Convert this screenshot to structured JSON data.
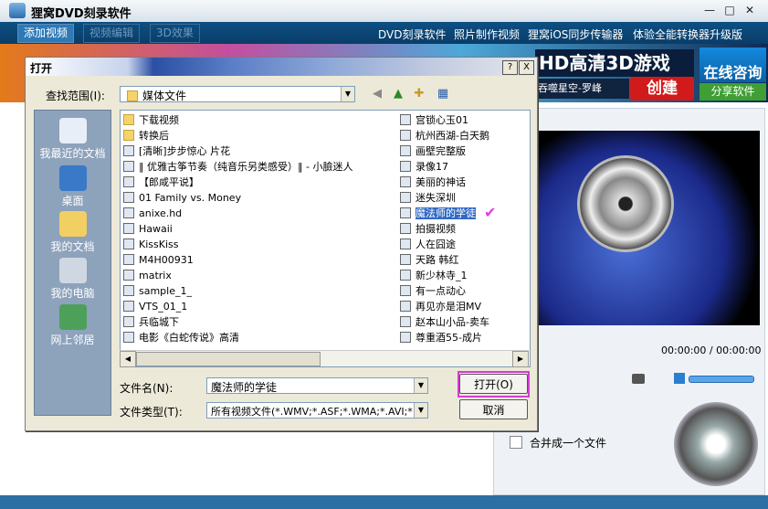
{
  "app": {
    "title": "狸窝DVD刻录软件",
    "min": "—",
    "max": "□",
    "close": "✕"
  },
  "toolbar": {
    "add_video": "添加视频",
    "edit_video": "视频编辑",
    "effect_3d": "3D效果",
    "links": [
      "DVD刻录软件",
      "照片制作视频",
      "狸窝iOS同步传输器",
      "体验全能转换器升级版"
    ]
  },
  "ad": {
    "headline": "HD高清3D游戏",
    "sub": "吞噬星空-罗峰",
    "create": "创建",
    "consult": "在线咨询",
    "share": "分享软件"
  },
  "player": {
    "time": "00:00:00 / 00:00:00"
  },
  "merge_label": "合并成一个文件",
  "dialog": {
    "title": "打开",
    "help": "?",
    "close": "X",
    "lookin_label": "查找范围(I):",
    "lookin_value": "媒体文件",
    "places": [
      "我最近的文档",
      "桌面",
      "我的文档",
      "我的电脑",
      "网上邻居"
    ],
    "files_left": [
      {
        "name": "下载视频",
        "type": "folder"
      },
      {
        "name": "转换后",
        "type": "folder"
      },
      {
        "name": "[清晰]步步惊心 片花",
        "type": "QT"
      },
      {
        "name": "‖ 优雅古筝节奏（纯音乐另类感受）‖ - 小臉迷人",
        "type": "WAV"
      },
      {
        "name": "【郎咸平说】",
        "type": "FLV"
      },
      {
        "name": "01 Family vs. Money",
        "type": "MKV"
      },
      {
        "name": "anixe.hd",
        "type": "TS"
      },
      {
        "name": "Hawaii",
        "type": "MPG"
      },
      {
        "name": "KissKiss",
        "type": "QT"
      },
      {
        "name": "M4H00931",
        "type": "QT"
      },
      {
        "name": "matrix",
        "type": "MP4"
      },
      {
        "name": "sample_1_",
        "type": "VOB"
      },
      {
        "name": "VTS_01_1",
        "type": "VOB"
      },
      {
        "name": "兵临城下",
        "type": "FLV"
      },
      {
        "name": "电影《白蛇传说》高清",
        "type": "FLV"
      }
    ],
    "files_right": [
      {
        "name": "宫锁心玉01",
        "type": "RM"
      },
      {
        "name": "杭州西湖-白天鹅",
        "type": "QT"
      },
      {
        "name": "画壁完整版",
        "type": "MP4"
      },
      {
        "name": "录像17",
        "type": "MP4"
      },
      {
        "name": "美丽的神话",
        "type": "MP4"
      },
      {
        "name": "迷失深圳",
        "type": "RM"
      },
      {
        "name": "魔法师的学徒",
        "type": "MP4",
        "selected": true
      },
      {
        "name": "拍摄视频",
        "type": "3GP"
      },
      {
        "name": "人在囧途",
        "type": "QT"
      },
      {
        "name": "天路 韩红",
        "type": "QT"
      },
      {
        "name": "新少林寺_1",
        "type": "MP4"
      },
      {
        "name": "有一点动心",
        "type": "WAV"
      },
      {
        "name": "再见亦是泪MV",
        "type": "FLV"
      },
      {
        "name": "赵本山小品-卖车",
        "type": "MP4"
      },
      {
        "name": "尊重酒55-成片",
        "type": "MP4"
      }
    ],
    "check_mark": "✔",
    "filename_label": "文件名(N):",
    "filename_value": "魔法师的学徒",
    "filetype_label": "文件类型(T):",
    "filetype_value": "所有视频文件(*.WMV;*.ASF;*.WMA;*.AVI;*",
    "open_button": "打开(O)",
    "cancel_button": "取消"
  },
  "colors": {
    "accent_highlight": "#d43cd4",
    "selection": "#316ac5",
    "places_bg": "#8da2bb"
  }
}
